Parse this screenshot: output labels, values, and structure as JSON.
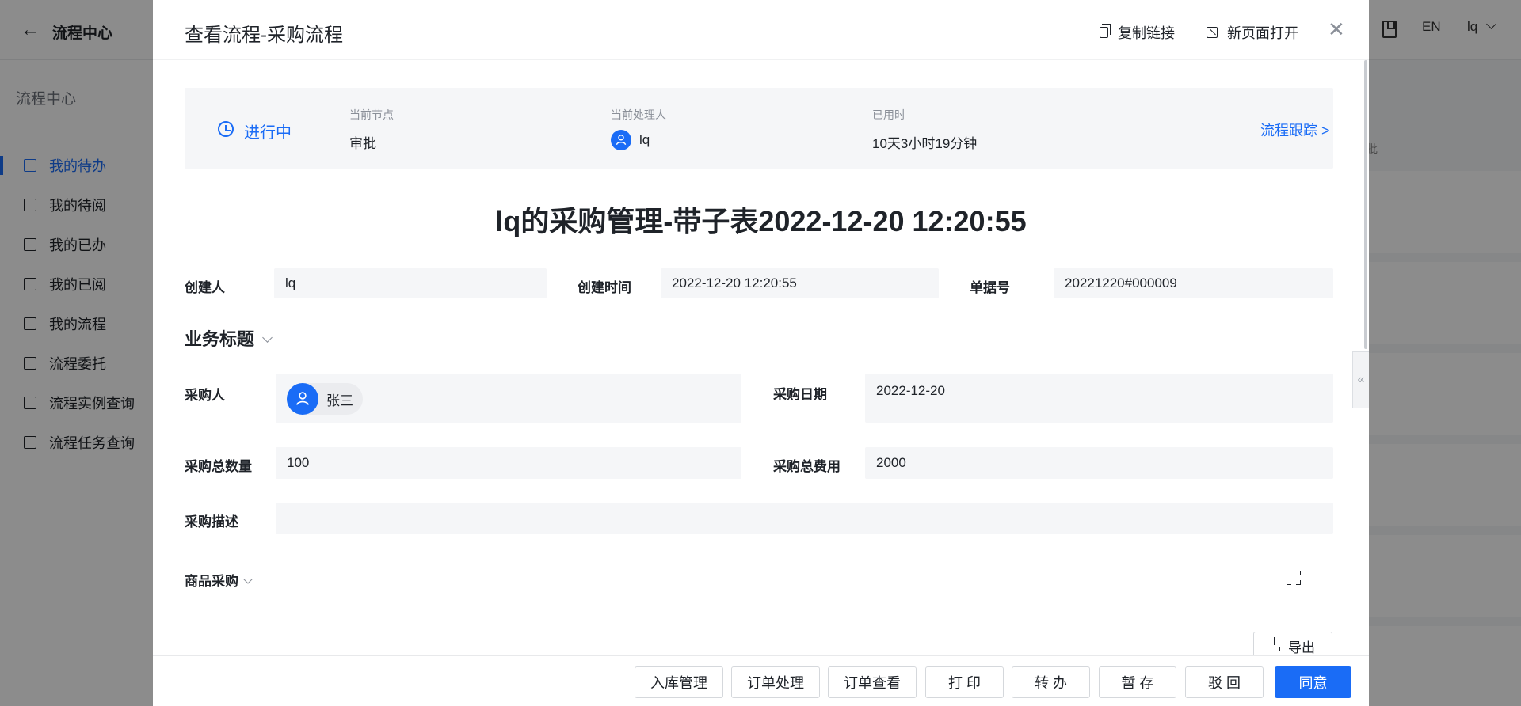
{
  "app": {
    "title": "流程中心",
    "lang": "EN",
    "user": "lq"
  },
  "sidebar": {
    "heading": "流程中心",
    "items": [
      {
        "label": "我的待办"
      },
      {
        "label": "我的待阅"
      },
      {
        "label": "我的已办"
      },
      {
        "label": "我的已阅"
      },
      {
        "label": "我的流程"
      },
      {
        "label": "流程委托"
      },
      {
        "label": "流程实例查询"
      },
      {
        "label": "流程任务查询"
      }
    ]
  },
  "background": {
    "column_text": "批"
  },
  "drawer": {
    "title": "查看流程-采购流程",
    "copy_link": "复制链接",
    "open_new_page": "新页面打开"
  },
  "status": {
    "state": "进行中",
    "node_label": "当前节点",
    "node_value": "审批",
    "handler_label": "当前处理人",
    "handler_value": "lq",
    "elapsed_label": "已用时",
    "elapsed_value": "10天3小时19分钟",
    "trace_link": "流程跟踪 >"
  },
  "document": {
    "title": "lq的采购管理-带子表2022-12-20 12:20:55",
    "creator_label": "创建人",
    "creator_value": "lq",
    "created_time_label": "创建时间",
    "created_time_value": "2022-12-20 12:20:55",
    "doc_no_label": "单据号",
    "doc_no_value": "20221220#000009"
  },
  "business": {
    "section_title": "业务标题",
    "purchaser_label": "采购人",
    "purchaser_value": "张三",
    "purchase_date_label": "采购日期",
    "purchase_date_value": "2022-12-20",
    "total_qty_label": "采购总数量",
    "total_qty_value": "100",
    "total_cost_label": "采购总费用",
    "total_cost_value": "2000",
    "description_label": "采购描述",
    "description_value": ""
  },
  "subtable": {
    "title": "商品采购",
    "export_label": "导出"
  },
  "footer": {
    "buttons": [
      "入库管理",
      "订单处理",
      "订单查看",
      "打 印",
      "转 办",
      "暂 存",
      "驳 回",
      "同意"
    ]
  },
  "colors": {
    "accent": "#1a6cf6",
    "field_bg": "#f5f6f8"
  }
}
